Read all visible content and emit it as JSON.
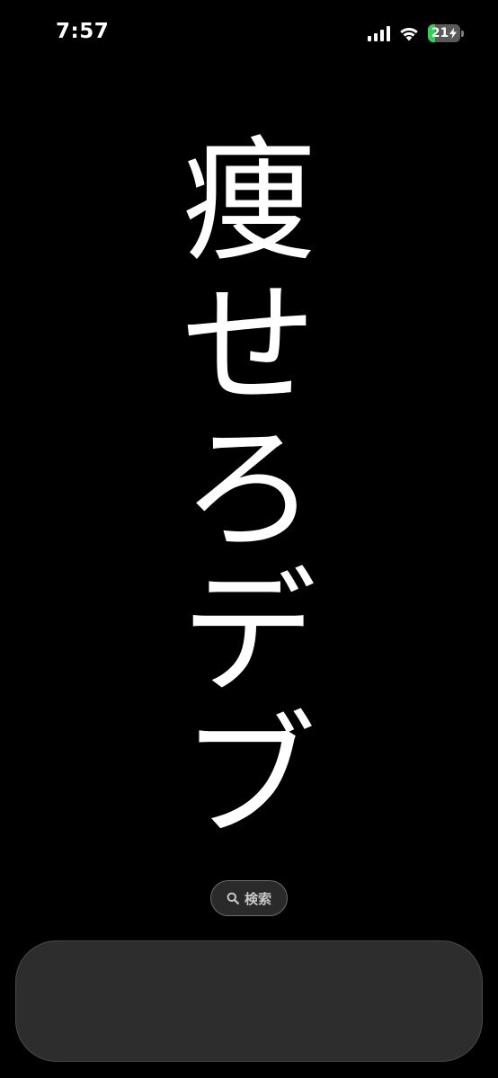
{
  "status_bar": {
    "time": "7:57",
    "battery_level": "21",
    "battery_charging": true,
    "battery_color": "#30d158",
    "signal_icon": "cellular-signal-icon",
    "wifi_icon": "wifi-icon",
    "charging_icon": "bolt-icon"
  },
  "wallpaper": {
    "characters": [
      "痩",
      "せ",
      "ろ",
      "デ",
      "ブ"
    ]
  },
  "search": {
    "label": "検索",
    "icon": "search-icon"
  }
}
